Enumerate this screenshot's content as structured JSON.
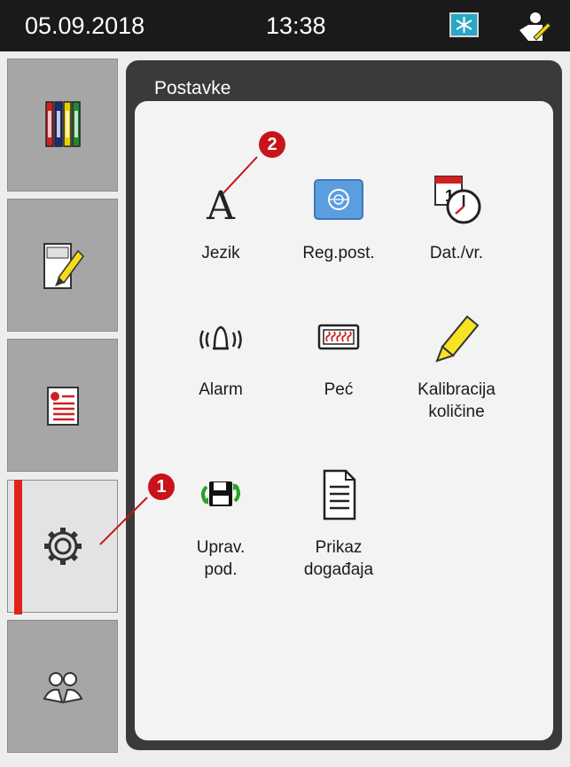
{
  "status_bar": {
    "date": "05.09.2018",
    "time": "13:38"
  },
  "sidebar": {
    "tabs": [
      {
        "name": "stations"
      },
      {
        "name": "slides"
      },
      {
        "name": "program"
      },
      {
        "name": "settings"
      },
      {
        "name": "users"
      }
    ],
    "active_tab": "settings"
  },
  "panel": {
    "title": "Postavke",
    "items": [
      {
        "label": "Jezik"
      },
      {
        "label": "Reg.post."
      },
      {
        "label": "Dat./vr."
      },
      {
        "label": "Alarm"
      },
      {
        "label": "Peć"
      },
      {
        "label_line1": "Kalibracija",
        "label_line2": "količine"
      },
      {
        "label_line1": "Uprav.",
        "label_line2": "pod."
      },
      {
        "label_line1": "Prikaz",
        "label_line2": "događaja"
      }
    ]
  },
  "callouts": [
    "1",
    "2"
  ],
  "colors": {
    "status_bar": "#1a1a1a",
    "accent": "#e0221c",
    "callout": "#c8131a",
    "panel_header": "#3a3a3a"
  }
}
